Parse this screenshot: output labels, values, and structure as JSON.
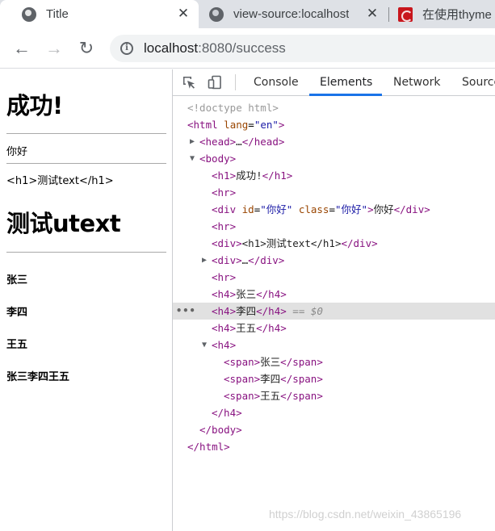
{
  "tabs": [
    {
      "title": "Title",
      "icon": "globe-icon",
      "close": "✕"
    },
    {
      "title": "view-source:localhost",
      "icon": "globe-icon",
      "close": "✕"
    },
    {
      "title": "在使用thyme",
      "icon": "csdn-logo-icon"
    }
  ],
  "toolbar": {
    "back_icon": "←",
    "forward_icon": "→",
    "reload_icon": "↻",
    "info_icon": "i",
    "url_host": "localhost",
    "url_rest": ":8080/success"
  },
  "page": {
    "h1_success": "成功!",
    "div_hello": "你好",
    "div_raw": "<h1>测试text</h1>",
    "h1_utext": "测试utext",
    "h4_items": [
      "张三",
      "李四",
      "王五"
    ],
    "h4_joined": "张三李四王五"
  },
  "devtools": {
    "tabs": [
      "Console",
      "Elements",
      "Network",
      "Source"
    ],
    "active_tab": "Elements",
    "tree": {
      "doctype": "<!doctype html>",
      "html_open_tag": "<html",
      "html_attr": "lang",
      "html_attr_val": "\"en\"",
      "html_open_close": ">",
      "head": "<head>",
      "head_ellipsis": "…",
      "head_close": "</head>",
      "body_open": "<body>",
      "h1_open": "<h1>",
      "h1_text": "成功!",
      "h1_close": "</h1>",
      "hr": "<hr>",
      "div_open": "<div",
      "id_attr": "id",
      "id_val": "\"你好\"",
      "class_attr": "class",
      "class_val": "\"你好\"",
      "div_gt": ">",
      "div_text": "你好",
      "div_close": "</div>",
      "div2_open": "<div>",
      "div2_text": "<h1>测试text</h1>",
      "div2_close": "</div>",
      "div3_open": "<div>",
      "div3_ellipsis": "…",
      "div3_close": "</div>",
      "h4_open": "<h4>",
      "h4_close": "</h4>",
      "h4_1": "张三",
      "h4_2": "李四",
      "h4_3": "王五",
      "selected_marker": "== $0",
      "selected_dots": "•••",
      "span_open": "<span>",
      "span_close": "</span>",
      "body_close": "</body>",
      "html_close": "</html>"
    }
  },
  "watermark": "https://blog.csdn.net/weixin_43865196"
}
